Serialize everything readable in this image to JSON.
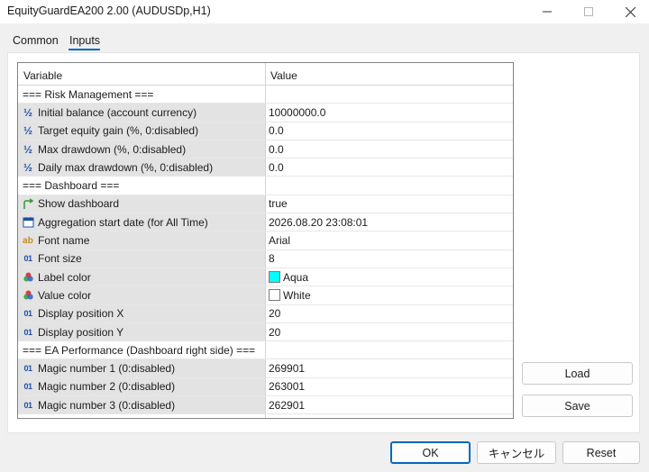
{
  "window": {
    "title": "EquityGuardEA200 2.00 (AUDUSDp,H1)"
  },
  "tabs": [
    {
      "label": "Common",
      "active": false
    },
    {
      "label": "Inputs",
      "active": true
    }
  ],
  "grid": {
    "headers": {
      "variable": "Variable",
      "value": "Value"
    },
    "rows": [
      {
        "type": "section",
        "label": "=== Risk Management ===",
        "value": ""
      },
      {
        "type": "param",
        "icon": "fraction-icon",
        "label": "Initial balance (account currency)",
        "value": "10000000.0"
      },
      {
        "type": "param",
        "icon": "fraction-icon",
        "label": "Target equity gain (%, 0:disabled)",
        "value": "0.0"
      },
      {
        "type": "param",
        "icon": "fraction-icon",
        "label": "Max drawdown (%, 0:disabled)",
        "value": "0.0"
      },
      {
        "type": "param",
        "icon": "fraction-icon",
        "label": "Daily max drawdown (%, 0:disabled)",
        "value": "0.0"
      },
      {
        "type": "section",
        "label": "=== Dashboard ===",
        "value": ""
      },
      {
        "type": "param",
        "icon": "boolean-arrow-icon",
        "label": "Show dashboard",
        "value": "true"
      },
      {
        "type": "param",
        "icon": "calendar-icon",
        "label": "Aggregation start date (for All Time)",
        "value": "2026.08.20 23:08:01"
      },
      {
        "type": "param",
        "icon": "string-ab-icon",
        "label": "Font name",
        "value": "Arial"
      },
      {
        "type": "param",
        "icon": "integer-icon",
        "label": "Font size",
        "value": "8"
      },
      {
        "type": "param",
        "icon": "color-icon",
        "label": "Label color",
        "value": "Aqua",
        "swatch": "#00ffff"
      },
      {
        "type": "param",
        "icon": "color-icon",
        "label": "Value color",
        "value": "White",
        "swatch": "#ffffff"
      },
      {
        "type": "param",
        "icon": "integer-icon",
        "label": "Display position X",
        "value": "20"
      },
      {
        "type": "param",
        "icon": "integer-icon",
        "label": "Display position Y",
        "value": "20"
      },
      {
        "type": "section",
        "label": "=== EA Performance (Dashboard right side) ===",
        "value": ""
      },
      {
        "type": "param",
        "icon": "integer-icon",
        "label": "Magic number 1 (0:disabled)",
        "value": "269901"
      },
      {
        "type": "param",
        "icon": "integer-icon",
        "label": "Magic number 2 (0:disabled)",
        "value": "263001"
      },
      {
        "type": "param",
        "icon": "integer-icon",
        "label": "Magic number 3 (0:disabled)",
        "value": "262901"
      }
    ]
  },
  "side_buttons": {
    "load": "Load",
    "save": "Save"
  },
  "footer": {
    "ok": "OK",
    "cancel": "キャンセル",
    "reset": "Reset"
  },
  "colors": {
    "accent": "#0067c0",
    "param_bg": "#e3e3e3"
  }
}
